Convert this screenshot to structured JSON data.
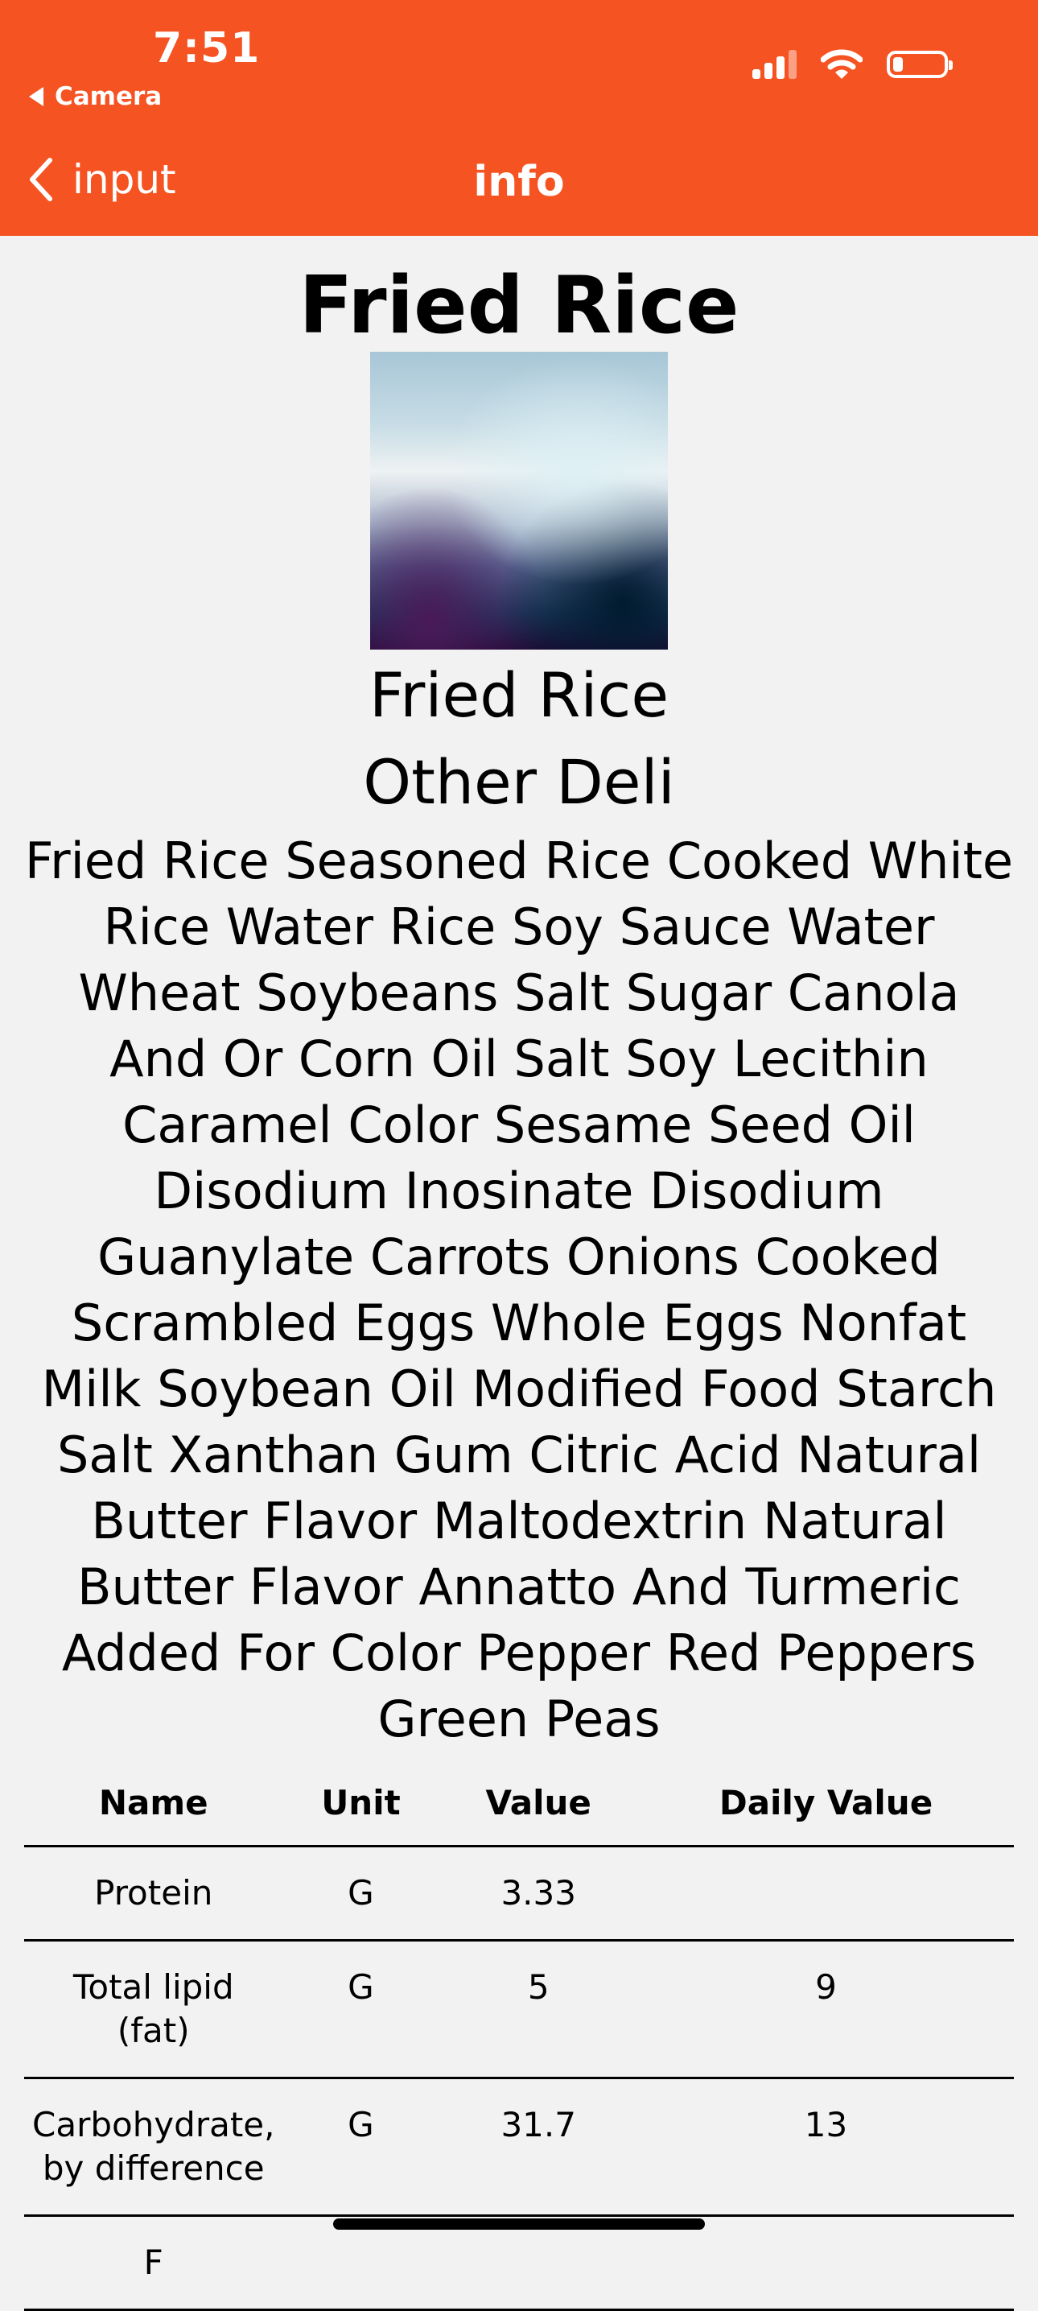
{
  "status_bar": {
    "time": "7:51",
    "back_app": "Camera",
    "battery_level": 0.2
  },
  "nav": {
    "back_label": "input",
    "title": "info"
  },
  "food": {
    "title": "Fried Rice",
    "name": "Fried Rice",
    "category": "Other Deli",
    "ingredients": "Fried Rice Seasoned Rice Cooked White Rice Water Rice Soy Sauce Water Wheat Soybeans Salt Sugar Canola And Or Corn Oil Salt Soy Lecithin Caramel Color Sesame Seed Oil Disodium Inosinate Disodium Guanylate Carrots Onions Cooked Scrambled Eggs Whole Eggs Nonfat Milk Soybean Oil Modified Food Starch Salt Xanthan Gum Citric Acid Natural Butter Flavor Maltodextrin Natural Butter Flavor Annatto And Turmeric Added For Color Pepper Red Peppers Green Peas"
  },
  "table": {
    "headers": [
      "Name",
      "Unit",
      "Value",
      "Daily Value"
    ],
    "rows": [
      {
        "name": "Protein",
        "unit": "G",
        "value": "3.33",
        "daily": ""
      },
      {
        "name": "Total lipid (fat)",
        "unit": "G",
        "value": "5",
        "daily": "9"
      },
      {
        "name": "Carbohydrate, by difference",
        "unit": "G",
        "value": "31.7",
        "daily": "13"
      },
      {
        "name": "F",
        "unit": "",
        "value": "",
        "daily": ""
      }
    ]
  }
}
